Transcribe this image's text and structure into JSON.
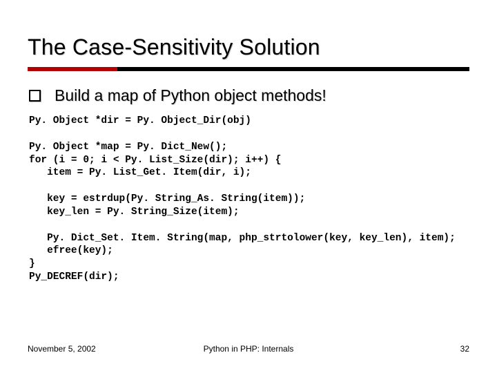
{
  "title": "The Case-Sensitivity Solution",
  "bullet": "Build a map of Python object methods!",
  "code": "Py. Object *dir = Py. Object_Dir(obj)\n\nPy. Object *map = Py. Dict_New();\nfor (i = 0; i < Py. List_Size(dir); i++) {\n   item = Py. List_Get. Item(dir, i);\n\n   key = estrdup(Py. String_As. String(item));\n   key_len = Py. String_Size(item);\n\n   Py. Dict_Set. Item. String(map, php_strtolower(key, key_len), item);\n   efree(key);\n}\nPy_DECREF(dir);",
  "footer": {
    "date": "November 5, 2002",
    "title": "Python in PHP: Internals",
    "page": "32"
  }
}
